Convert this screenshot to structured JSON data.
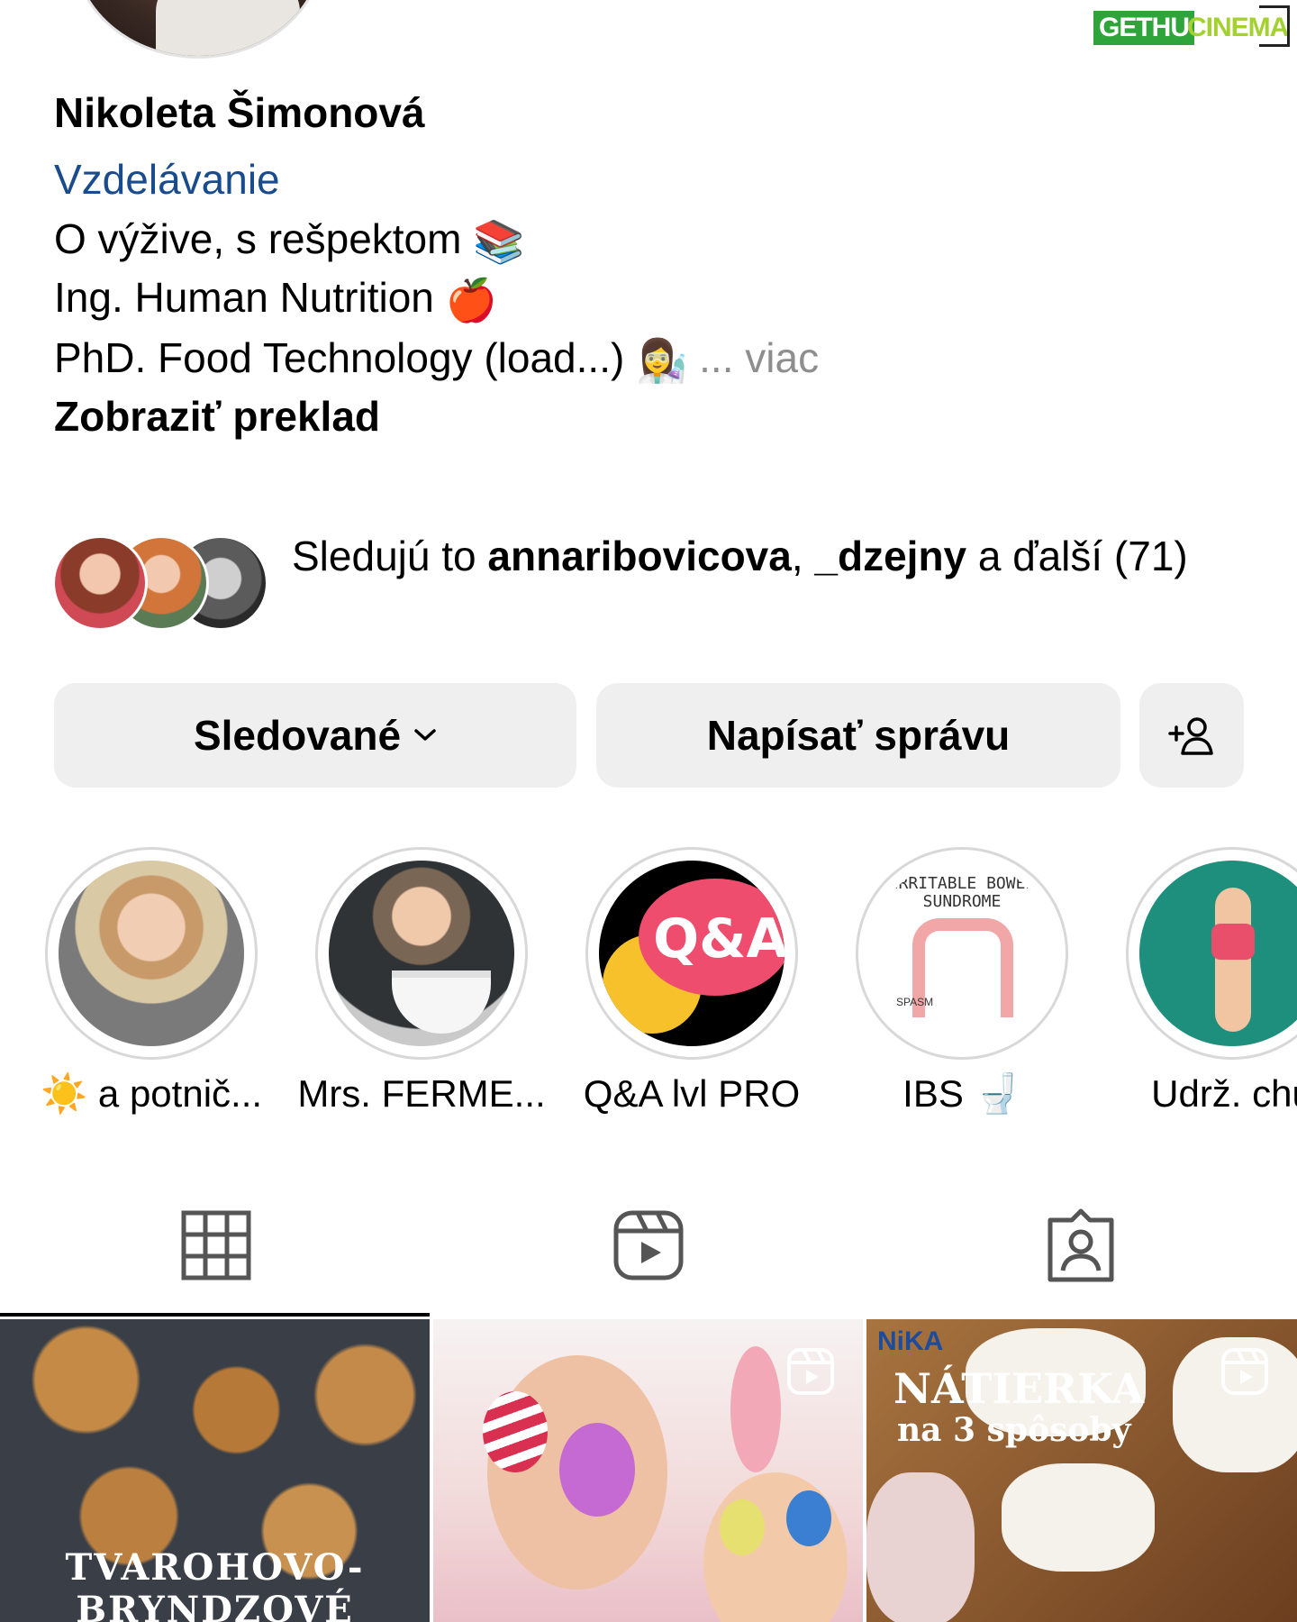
{
  "watermark": {
    "part1": "GETHU",
    "part2": "CINEMA"
  },
  "profile": {
    "name": "Nikoleta Šimonová",
    "category": "Vzdelávanie",
    "bio_line1": "O výžive, s rešpektom",
    "bio_line1_emoji": "📚",
    "bio_line2": "Ing. Human Nutrition",
    "bio_line2_emoji": "🍎",
    "bio_line3": "PhD. Food Technology (load...)",
    "bio_line3_emoji": "👩‍🔬",
    "more": "... viac",
    "translate": "Zobraziť preklad"
  },
  "followed_by": {
    "prefix": "Sledujú to ",
    "user1": "annaribovicova",
    "sep": ", ",
    "user2": "_dzejny",
    "suffix": " a ďalší (71)"
  },
  "buttons": {
    "following": "Sledované",
    "message": "Napísať správu",
    "add_user_icon": "add-person-icon"
  },
  "highlights": [
    {
      "label": "☀️ a potnič..."
    },
    {
      "label": "Mrs. FERME..."
    },
    {
      "label": "Q&A lvl PRO",
      "cover_text": "Q&A"
    },
    {
      "label": "IBS 🚽",
      "cover_text": "IRRITABLE BOWEL SUNDROME",
      "cover_sub": "SPASM",
      "cover_tag": "IBS"
    },
    {
      "label": "Udrž. chu"
    }
  ],
  "tabs": [
    {
      "icon": "grid-icon",
      "active": true
    },
    {
      "icon": "reels-icon",
      "active": false
    },
    {
      "icon": "tagged-icon",
      "active": false
    }
  ],
  "posts": [
    {
      "caption": "TVAROHOVO-BRYNDZOVÉ"
    },
    {
      "caption": ""
    },
    {
      "brand": "NiKA",
      "title": "NÁTIERKA",
      "subtitle": "na 3 spôsoby"
    }
  ],
  "colors": {
    "category_link": "#1a4b8c",
    "muted": "#8e8e8e",
    "button_bg": "#efefef"
  }
}
